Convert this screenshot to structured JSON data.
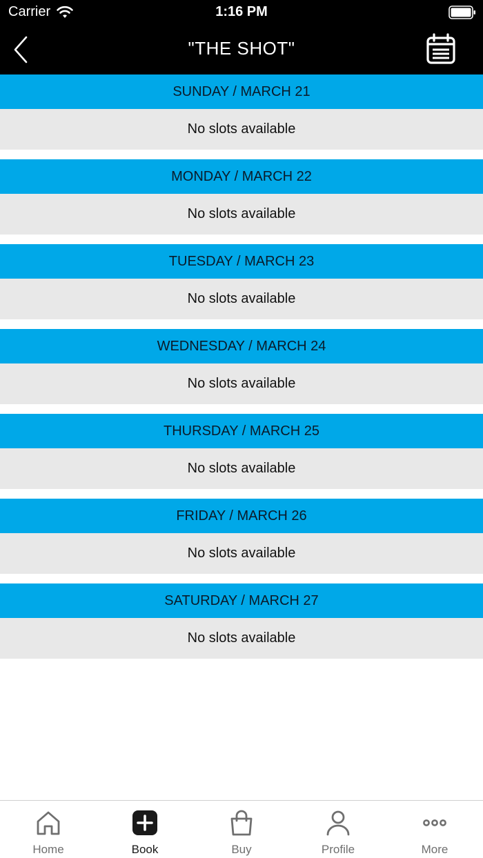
{
  "status_bar": {
    "carrier": "Carrier",
    "time": "1:16 PM"
  },
  "nav": {
    "title": "\"THE SHOT\""
  },
  "days": [
    {
      "label": "SUNDAY / MARCH 21",
      "message": "No slots available"
    },
    {
      "label": "MONDAY / MARCH 22",
      "message": "No slots available"
    },
    {
      "label": "TUESDAY / MARCH 23",
      "message": "No slots available"
    },
    {
      "label": "WEDNESDAY / MARCH 24",
      "message": "No slots available"
    },
    {
      "label": "THURSDAY / MARCH 25",
      "message": "No slots available"
    },
    {
      "label": "FRIDAY / MARCH 26",
      "message": "No slots available"
    },
    {
      "label": "SATURDAY / MARCH 27",
      "message": "No slots available"
    }
  ],
  "tabs": [
    {
      "label": "Home",
      "icon": "home-icon",
      "active": false
    },
    {
      "label": "Book",
      "icon": "plus-square-icon",
      "active": true
    },
    {
      "label": "Buy",
      "icon": "shopping-bag-icon",
      "active": false
    },
    {
      "label": "Profile",
      "icon": "person-icon",
      "active": false
    },
    {
      "label": "More",
      "icon": "more-dots-icon",
      "active": false
    }
  ],
  "colors": {
    "header_bg": "#000000",
    "day_header_bg": "#00a8e8",
    "day_body_bg": "#e8e8e8"
  }
}
